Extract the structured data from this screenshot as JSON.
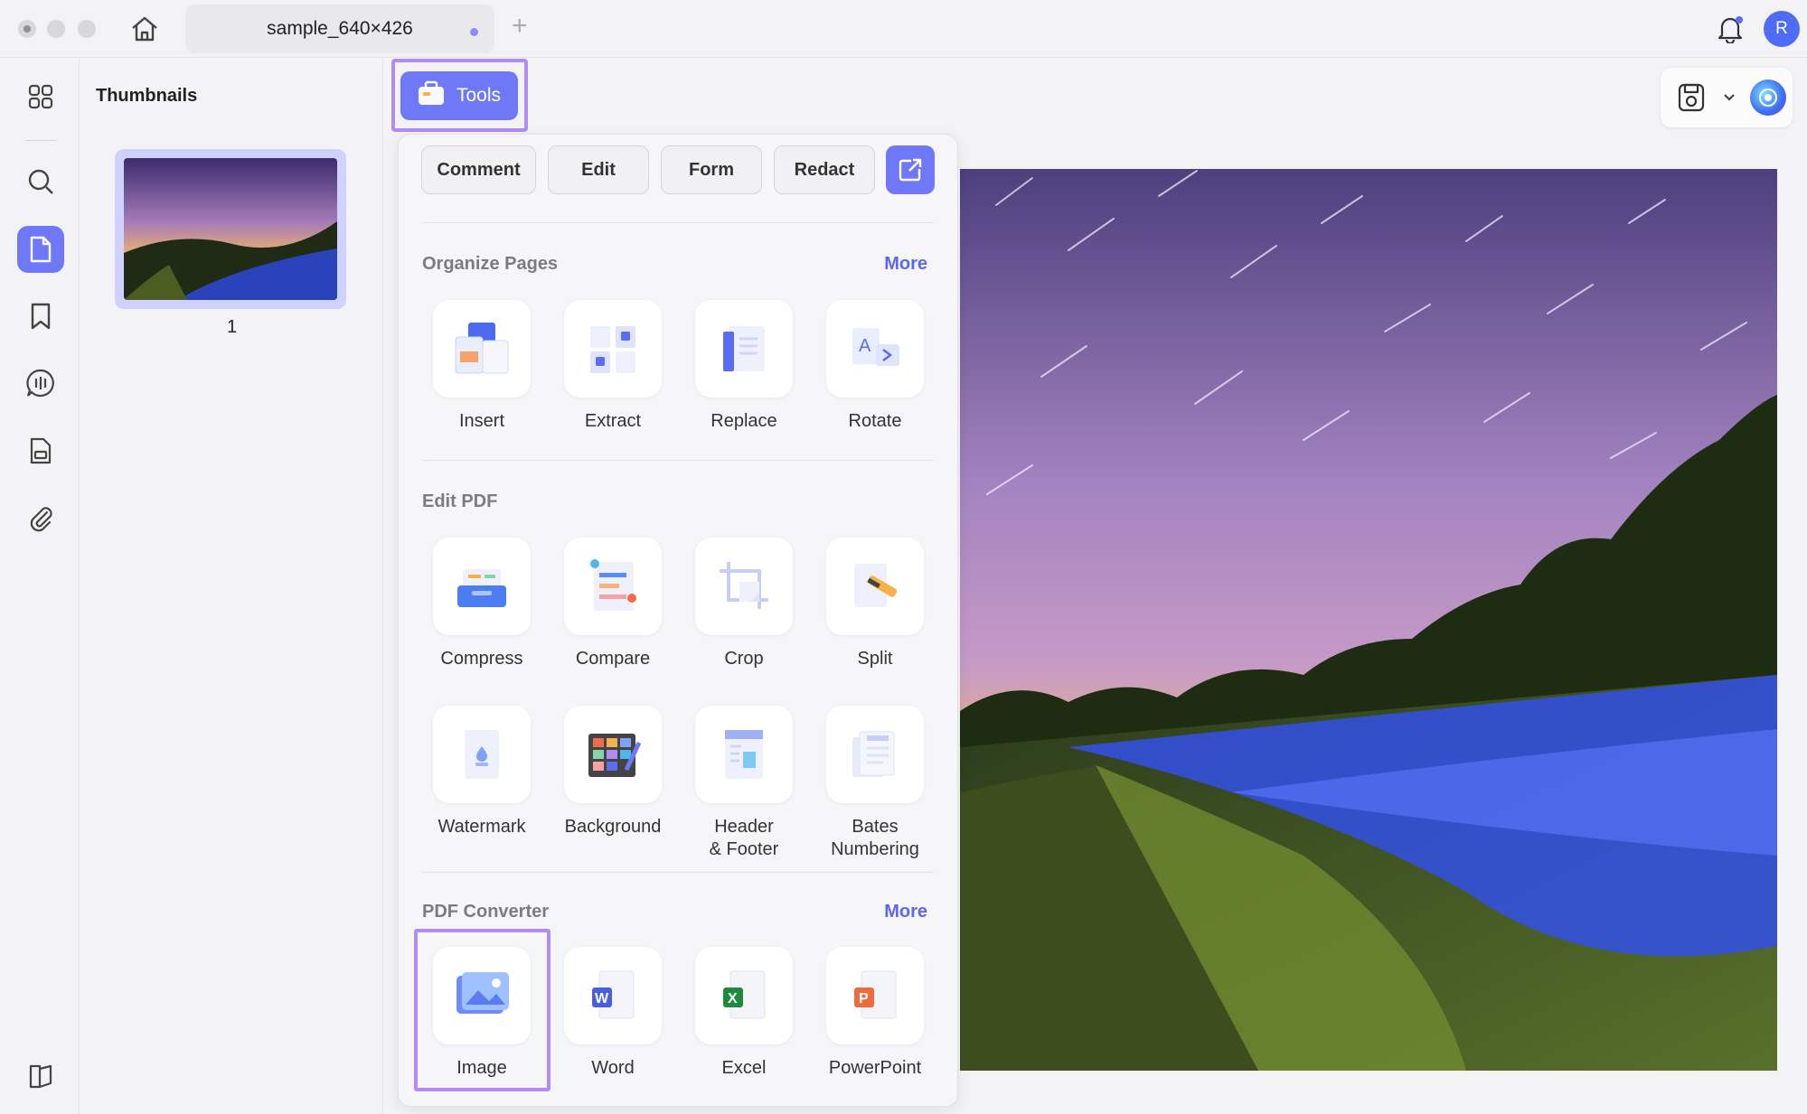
{
  "window": {
    "tab_title": "sample_640×426",
    "avatar_initial": "R"
  },
  "rail": {
    "items": [
      "apps-icon",
      "search-icon",
      "pages-icon",
      "bookmark-icon",
      "ai-chat-icon",
      "forms-icon",
      "attachment-icon"
    ],
    "bottom": "sidebar-toggle-icon"
  },
  "thumbnails": {
    "title": "Thumbnails",
    "pages": [
      {
        "number": "1"
      }
    ]
  },
  "toolbar": {
    "tools_label": "Tools"
  },
  "panel": {
    "modes": [
      "Comment",
      "Edit",
      "Form",
      "Redact"
    ],
    "sections": [
      {
        "title": "Organize Pages",
        "more": "More",
        "tools": [
          "Insert",
          "Extract",
          "Replace",
          "Rotate"
        ]
      },
      {
        "title": "Edit PDF",
        "more": "",
        "tools": [
          "Compress",
          "Compare",
          "Crop",
          "Split",
          "Watermark",
          "Background",
          "Header\n& Footer",
          "Bates\nNumbering"
        ]
      },
      {
        "title": "PDF Converter",
        "more": "More",
        "tools": [
          "Image",
          "Word",
          "Excel",
          "PowerPoint"
        ]
      }
    ]
  },
  "colors": {
    "accent": "#6f79f7",
    "highlight": "#b18cf5",
    "link": "#5b67f0"
  }
}
